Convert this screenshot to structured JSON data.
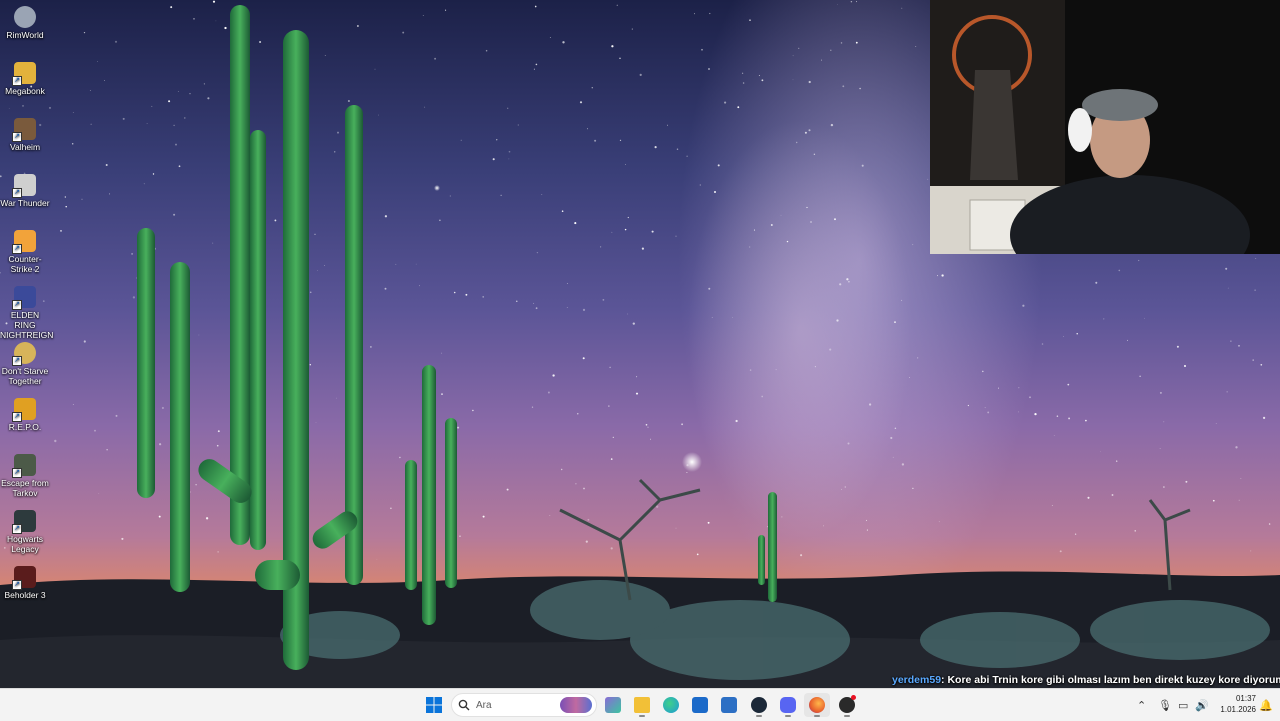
{
  "desktop": {
    "icons": [
      {
        "label": "RimWorld",
        "icon": "rimworld-icon",
        "color": "#9aa4b4"
      },
      {
        "label": "Megabonk",
        "icon": "megabonk-icon",
        "color": "#e3b23c"
      },
      {
        "label": "Valheim",
        "icon": "valheim-icon",
        "color": "#7a5a3c"
      },
      {
        "label": "War Thunder",
        "icon": "war-thunder-icon",
        "color": "#cfcfcf"
      },
      {
        "label": "Counter-Strike 2",
        "icon": "counter-strike-icon",
        "color": "#f2a33a"
      },
      {
        "label": "ELDEN RING NIGHTREIGN",
        "icon": "elden-ring-icon",
        "color": "#3b4a9a"
      },
      {
        "label": "Don't Starve Together",
        "icon": "dont-starve-icon",
        "color": "#d7b45a"
      },
      {
        "label": "R.E.P.O.",
        "icon": "repo-icon",
        "color": "#e0a022"
      },
      {
        "label": "Escape from Tarkov",
        "icon": "tarkov-icon",
        "color": "#4c5a48"
      },
      {
        "label": "Hogwarts Legacy",
        "icon": "hogwarts-icon",
        "color": "#2d3a3d"
      },
      {
        "label": "Beholder 3",
        "icon": "beholder-icon",
        "color": "#5a1c1c"
      }
    ]
  },
  "chat": {
    "username": "yerdem59",
    "message": ": Kore abi Trnin kore gibi olması lazım ben direkt kuzey kore diyorum"
  },
  "taskbar": {
    "search_placeholder": "Ara",
    "apps": [
      {
        "name": "start-button",
        "icon": "windows-icon",
        "color": "#0a74da"
      },
      {
        "name": "widgets-button",
        "icon": "widgets-icon",
        "color": "#8a6bd6"
      },
      {
        "name": "task-view-button",
        "icon": "task-view-icon",
        "color": "#3b8ed8"
      },
      {
        "name": "file-explorer-button",
        "icon": "folder-icon",
        "color": "#f2c037"
      },
      {
        "name": "edge-button",
        "icon": "edge-icon",
        "color": "#1e9ad6"
      },
      {
        "name": "store-button",
        "icon": "store-icon",
        "color": "#1b6ac9"
      },
      {
        "name": "outlook-button",
        "icon": "outlook-icon",
        "color": "#2c6fc4"
      },
      {
        "name": "steam-button",
        "icon": "steam-icon",
        "color": "#1b2838"
      },
      {
        "name": "discord-button",
        "icon": "discord-icon",
        "color": "#5865f2"
      },
      {
        "name": "firefox-button",
        "icon": "firefox-icon",
        "color": "#e8602c"
      },
      {
        "name": "obs-button",
        "icon": "obs-icon",
        "color": "#2a2a2a"
      }
    ],
    "tray": {
      "time": "01:37",
      "date": "1.01.2026"
    }
  }
}
